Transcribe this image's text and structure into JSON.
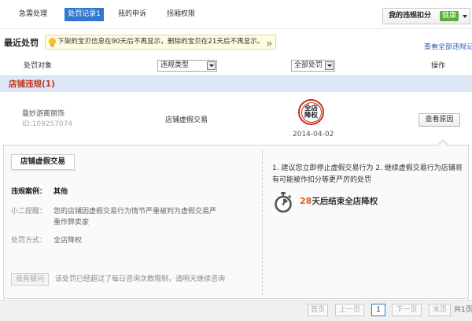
{
  "top_tabs": [
    {
      "label": "急需处理"
    },
    {
      "label": "处罚记录",
      "count": "1",
      "selected": true
    },
    {
      "label": "我的申诉"
    },
    {
      "label": "拐厢权限"
    }
  ],
  "score_box": {
    "label": "我的违规扣分",
    "status": "健康"
  },
  "recent": {
    "title": "最近处罚",
    "notice": "下架的宝贝信息在90天后不再显示，删除的宝贝在21天后不再显示。",
    "view_all": "查看全部违规记"
  },
  "table": {
    "col_object": "处罚对象",
    "type_filter": {
      "selected": "违规类型"
    },
    "penalty_filter": {
      "selected": "全部处罚"
    },
    "col_action": "操作"
  },
  "group": {
    "label": "店铺违规(1)"
  },
  "record": {
    "object_name": "曼妙游离丽饰",
    "object_id": "ID:109257074",
    "violation_type": "店铺虚假交易",
    "penalty_stamp": [
      "全店",
      "降权"
    ],
    "date": "2014-04-02",
    "action_label": "查看原因"
  },
  "detail": {
    "tab_label": "店铺虚假交易",
    "case_label": "违规案例：",
    "case_value": "其他",
    "tip_label": "小二提醒：",
    "tip_value": "您的店铺因虚假交易行为情节严重被判为虚假交易严重作弊卖家",
    "penalty_label": "处罚方式：",
    "penalty_value": "全店降权",
    "ask_button": "我有疑问",
    "ask_note": "该处罚已经超过了每日咨询次数限制，请明天继续咨询",
    "advice": "1. 建议您立即停止虚假交易行为 2. 继续虚假交易行为店铺将有可能被作扣分等更严厉的处罚",
    "countdown_days": "28",
    "countdown_text": "天后结束全店降权"
  },
  "pagination": {
    "first": "首页",
    "prev": "上一页",
    "current": "1",
    "next": "下一页",
    "last": "末页",
    "total": "共1页"
  },
  "icons": {
    "notice": "lightbulb-icon",
    "notice_more": "double-chevron-right-icon",
    "score_menu": "chevron-down-icon",
    "select_arrow": "dropdown-arrow-icon",
    "penalty_stamp": "penalty-stamp-icon",
    "countdown": "stopwatch-icon"
  },
  "colors": {
    "accent": "#3178d2",
    "danger": "#c2331f",
    "healthy": "#5cae3a",
    "section_band": "#dde7f5",
    "link": "#2a5db0",
    "countdown": "#e8581c"
  }
}
